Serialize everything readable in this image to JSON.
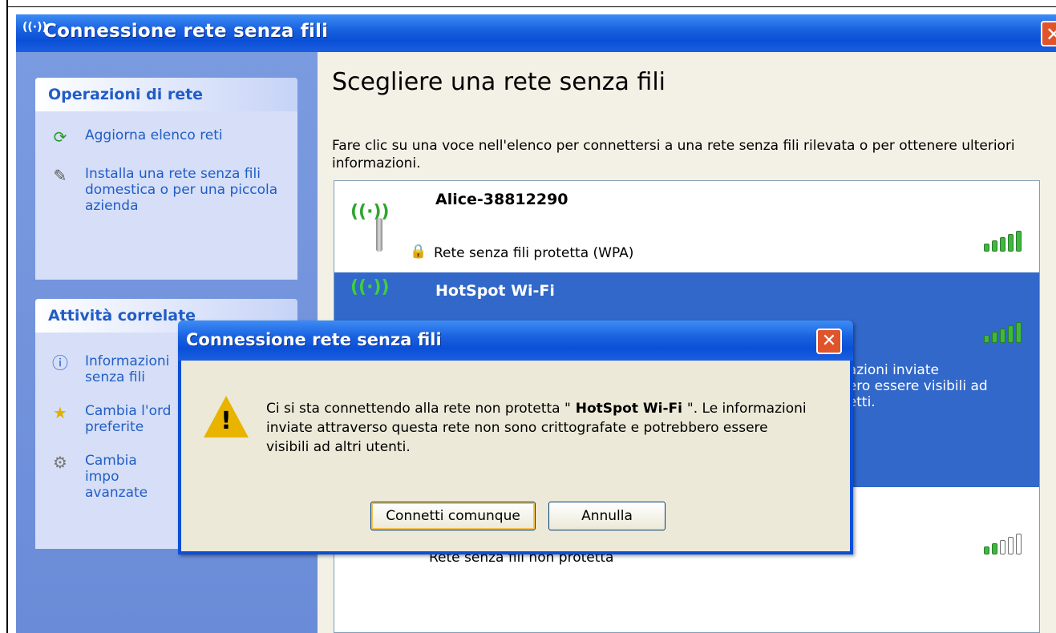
{
  "window": {
    "title": "Connessione rete senza fili",
    "title_icon": "wireless-icon",
    "close_label": "✕"
  },
  "taskpane": {
    "network_tasks": {
      "heading": "Operazioni di rete",
      "items": [
        {
          "label": "Aggiorna elenco reti",
          "icon": "refresh-icon"
        },
        {
          "label": "Installa una rete senza fili domestica o per una piccola azienda",
          "icon": "setup-wireless-icon"
        }
      ]
    },
    "related_tasks": {
      "heading": "Attività correlate",
      "items": [
        {
          "label": "Informazioni senza fili",
          "icon": "info-icon"
        },
        {
          "label": "Cambia l'ord preferite",
          "icon": "star-icon"
        },
        {
          "label": "Cambia impo avanzate",
          "icon": "settings-icon"
        }
      ]
    }
  },
  "content": {
    "heading": "Scegliere una rete senza fili",
    "description": "Fare clic su una voce nell'elenco per connettersi a una rete senza fili rilevata o per ottenere ulteriori informazioni.",
    "networks": [
      {
        "name": "Alice-38812290",
        "status": "Rete senza fili protetta (WPA)",
        "secured": true,
        "signal_bars": 5,
        "selected": false
      },
      {
        "name": "HotSpot Wi-Fi",
        "status": "",
        "secured": false,
        "signal_bars": 5,
        "selected": true,
        "extra_lines": [
          "nazioni inviate",
          "pero essere visibili ad",
          "netti."
        ]
      },
      {
        "name": "",
        "status": "Rete senza fili non protetta",
        "secured": false,
        "signal_bars": 2,
        "selected": false
      }
    ]
  },
  "dialog": {
    "title": "Connessione rete senza fili",
    "close_label": "✕",
    "message_pre": "Ci si sta connettendo alla rete non protetta \"",
    "message_network": " HotSpot Wi-Fi ",
    "message_post": "\". Le informazioni inviate attraverso questa rete non sono crittografate e potrebbero essere visibili ad altri utenti.",
    "icon": "warning-icon",
    "buttons": {
      "connect": "Connetti comunque",
      "cancel": "Annulla"
    }
  },
  "colors": {
    "titlebar": "#0a4fd6",
    "selection": "#3168c9",
    "taskpane_link": "#215dc6",
    "signal_green": "#3fb83f"
  }
}
